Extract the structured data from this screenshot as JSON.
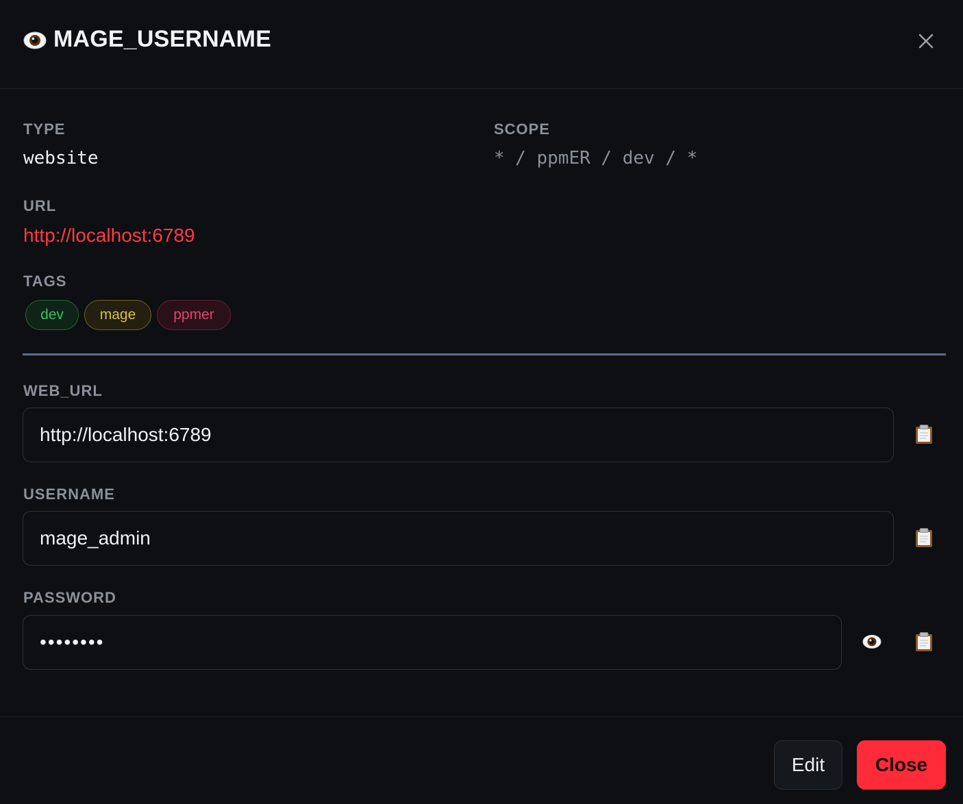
{
  "header": {
    "title": "MAGE_USERNAME",
    "icon": "eye-icon",
    "close_icon": "close-icon"
  },
  "meta": {
    "type_label": "TYPE",
    "type_value": "website",
    "scope_label": "SCOPE",
    "scope_value": "* / ppmER / dev / *",
    "url_label": "URL",
    "url_value": "http://localhost:6789",
    "tags_label": "TAGS",
    "tags": [
      {
        "label": "dev",
        "color": "#3fc05a"
      },
      {
        "label": "mage",
        "color": "#d8bd4a"
      },
      {
        "label": "ppmer",
        "color": "#e0456e"
      }
    ]
  },
  "fields": {
    "web_url": {
      "label": "WEB_URL",
      "value": "http://localhost:6789"
    },
    "username": {
      "label": "USERNAME",
      "value": "mage_admin"
    },
    "password": {
      "label": "PASSWORD",
      "value": "••••••••"
    }
  },
  "footer": {
    "edit_label": "Edit",
    "close_label": "Close"
  },
  "colors": {
    "accent": "#ff2b38",
    "url": "#ff3a44",
    "divider": "#5d6a8a",
    "background": "#0d0f12"
  }
}
